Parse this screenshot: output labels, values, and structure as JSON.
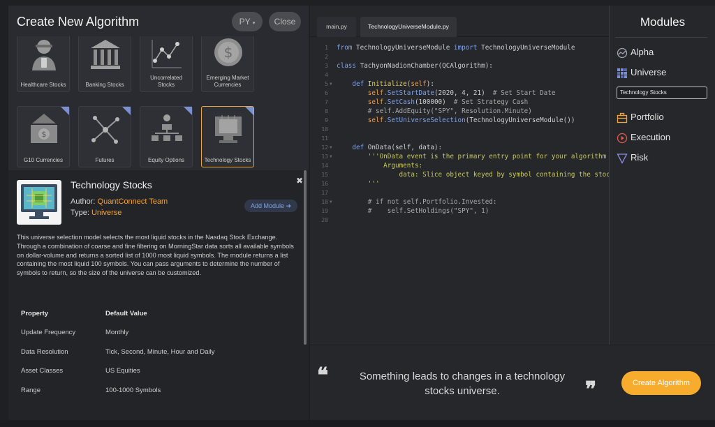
{
  "left": {
    "title": "Create New Algorithm",
    "language_label": "PY",
    "close_label": "Close"
  },
  "tiles": [
    {
      "label": "Healthcare Stocks",
      "icon": "doctor-icon",
      "corner": false,
      "selected": false
    },
    {
      "label": "Banking Stocks",
      "icon": "bank-icon",
      "corner": false,
      "selected": false
    },
    {
      "label": "Uncorrelated Stocks",
      "icon": "scatter-icon",
      "corner": false,
      "selected": false
    },
    {
      "label": "Emerging Market Currencies",
      "icon": "coin-icon",
      "corner": false,
      "selected": false
    },
    {
      "label": "G10 Currencies",
      "icon": "currency-bill-icon",
      "corner": true,
      "selected": false
    },
    {
      "label": "Futures",
      "icon": "network-icon",
      "corner": true,
      "selected": false
    },
    {
      "label": "Equity Options",
      "icon": "hierarchy-icon",
      "corner": true,
      "selected": false
    },
    {
      "label": "Technology Stocks",
      "icon": "cpu-chip-icon",
      "corner": true,
      "selected": true
    }
  ],
  "detail": {
    "title": "Technology Stocks",
    "author_label": "Author:",
    "author": "QuantConnect Team",
    "type_label": "Type:",
    "type": "Universe",
    "add_module_label": "Add Module",
    "description": "This universe selection model selects the most liquid stocks in the Nasdaq Stock Exchange. Through a combination of coarse and fine filtering on MorningStar data sorts all available symbols on dollar-volume and returns a sorted list of 1000 most liquid symbols. The module returns a list containing the most liquid 100 symbols. You can pass arguments to determine the number of symbols to return, so the size of the universe can be customized.",
    "properties": {
      "header": {
        "key": "Property",
        "value": "Default Value"
      },
      "rows": [
        {
          "key": "Update Frequency",
          "value": "Monthly"
        },
        {
          "key": "Data Resolution",
          "value": "Tick, Second, Minute, Hour and Daily"
        },
        {
          "key": "Asset Classes",
          "value": "US Equities"
        },
        {
          "key": "Range",
          "value": "100-1000 Symbols"
        }
      ]
    }
  },
  "editor": {
    "tabs": [
      "main.py",
      "TechnologyUniverseModule.py"
    ],
    "active_tab": 1,
    "lines": [
      {
        "n": "1",
        "fold": false
      },
      {
        "n": "2",
        "fold": false
      },
      {
        "n": "3",
        "fold": false
      },
      {
        "n": "4",
        "fold": false
      },
      {
        "n": "5",
        "fold": true
      },
      {
        "n": "6",
        "fold": false
      },
      {
        "n": "7",
        "fold": false
      },
      {
        "n": "8",
        "fold": false
      },
      {
        "n": "9",
        "fold": false
      },
      {
        "n": "10",
        "fold": false
      },
      {
        "n": "11",
        "fold": false
      },
      {
        "n": "12",
        "fold": true
      },
      {
        "n": "13",
        "fold": true
      },
      {
        "n": "14",
        "fold": false
      },
      {
        "n": "15",
        "fold": false
      },
      {
        "n": "16",
        "fold": false
      },
      {
        "n": "17",
        "fold": false
      },
      {
        "n": "18",
        "fold": true
      },
      {
        "n": "19",
        "fold": false
      },
      {
        "n": "20",
        "fold": false
      }
    ],
    "code": {
      "l1_from": "from",
      "l1_mod": " TechnologyUniverseModule ",
      "l1_import": "import",
      "l1_name": " TechnologyUniverseModule",
      "l3_class": "class",
      "l3_rest": " TachyonNadionChamber(QCAlgorithm):",
      "l5_def": "def",
      "l5_rest": " Initialize(",
      "l5_self": "self",
      "l5_end": "):",
      "l6_self": "self",
      "l6_fn": ".SetStartDate",
      "l6_args": "(2020, 4, 21)",
      "l6_cm": "  # Set Start Date",
      "l7_self": "self",
      "l7_fn": ".SetCash",
      "l7_args": "(100000)",
      "l7_cm": "  # Set Strategy Cash",
      "l8_cm": "# self.AddEquity(\"SPY\", Resolution.Minute)",
      "l9_self": "self",
      "l9_fn": ".SetUniverseSelection",
      "l9_args": "(TechnologyUniverseModule())",
      "l12_def": "def",
      "l12_rest": " OnData(self, data):",
      "l13_str": "'''OnData event is the primary entry point for your algorithm",
      "l14_str": "    Arguments:",
      "l15_str": "        data: Slice object keyed by symbol containing the stock data",
      "l16_str": "'''",
      "l18_cm": "# if not self.Portfolio.Invested:",
      "l19_cm": "#    self.SetHoldings(\"SPY\", 1)"
    }
  },
  "modules": {
    "title": "Modules",
    "items": [
      {
        "label": "Alpha",
        "icon": "alpha-chart-icon",
        "color": "#9fa6b2"
      },
      {
        "label": "Universe",
        "icon": "universe-grid-icon",
        "color": "#7c8fcf"
      },
      {
        "label": "Portfolio",
        "icon": "briefcase-icon",
        "color": "#f2a33a"
      },
      {
        "label": "Execution",
        "icon": "play-circle-icon",
        "color": "#e0584a"
      },
      {
        "label": "Risk",
        "icon": "triangle-down-icon",
        "color": "#8f8fe6"
      }
    ],
    "search_value": "Technology Stocks"
  },
  "quote": {
    "text": "Something leads to changes in a technology stocks universe.",
    "create_label": "Create Algorithm"
  },
  "colors": {
    "accent": "#f7ac2e",
    "universe": "#7c8fcf"
  }
}
